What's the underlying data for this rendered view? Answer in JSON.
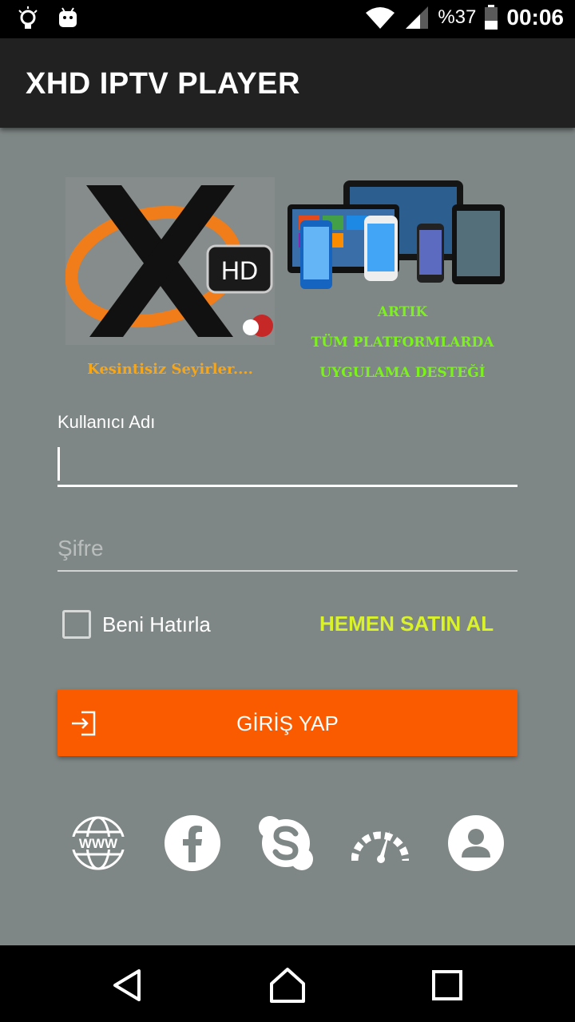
{
  "status_bar": {
    "battery_percent": "%37",
    "time": "00:06",
    "icons": [
      "lightbulb-icon",
      "android-icon",
      "wifi-icon",
      "signal-icon",
      "battery-icon"
    ]
  },
  "app_bar": {
    "title": "XHD IPTV PLAYER"
  },
  "branding": {
    "logo_text": "HD",
    "tagline": "Kesintisiz Seyirler....",
    "promo_lines": [
      "ARTIK",
      "TÜM PLATFORMLARDA",
      "UYGULAMA DESTEĞİ"
    ]
  },
  "form": {
    "username_label": "Kullanıcı Adı",
    "username_value": "",
    "password_placeholder": "Şifre",
    "password_value": "",
    "remember_label": "Beni Hatırla",
    "remember_checked": false,
    "buy_label": "HEMEN SATIN AL",
    "login_label": "GİRİŞ YAP"
  },
  "social": {
    "www_text": "WWW",
    "items": [
      "globe-www-icon",
      "facebook-icon",
      "skype-icon",
      "speedometer-icon",
      "user-profile-icon"
    ]
  },
  "nav": {
    "items": [
      "back-icon",
      "home-icon",
      "recents-icon"
    ]
  },
  "colors": {
    "background": "#7f8786",
    "app_bar": "#212121",
    "login_button": "#fb5b00",
    "buy_link": "#d9f22a",
    "promo_text": "#7cf21c",
    "tagline_text": "#f6a61a"
  }
}
